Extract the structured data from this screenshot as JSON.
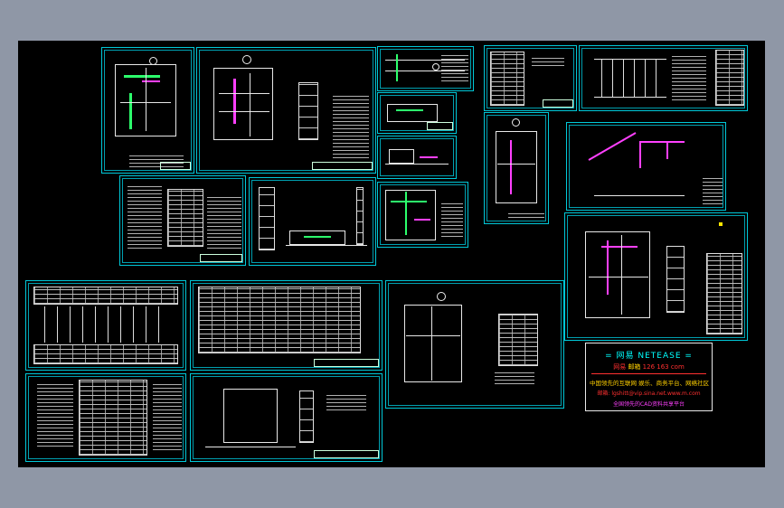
{
  "viewport": {
    "name": "cad-drawing-viewport"
  },
  "netease": {
    "title": "= 网易  NETEASE =",
    "brand": "网易 ",
    "highlight": "邮箱",
    "domain": " 126 163 com",
    "slogan": "中国领先的互联网  娱乐、商务平台、网络社区",
    "email_line": "邮箱:  lgshitt@vip.sina.net.www.m.com",
    "footer": "全国领先的CAD资料共享平台"
  },
  "colors": {
    "background": "#000000",
    "window": "#8f97a6",
    "sheet_border": "#00c8d8",
    "magenta": "#ff40ff",
    "green": "#2cff6c",
    "yellow": "#ffe600"
  }
}
